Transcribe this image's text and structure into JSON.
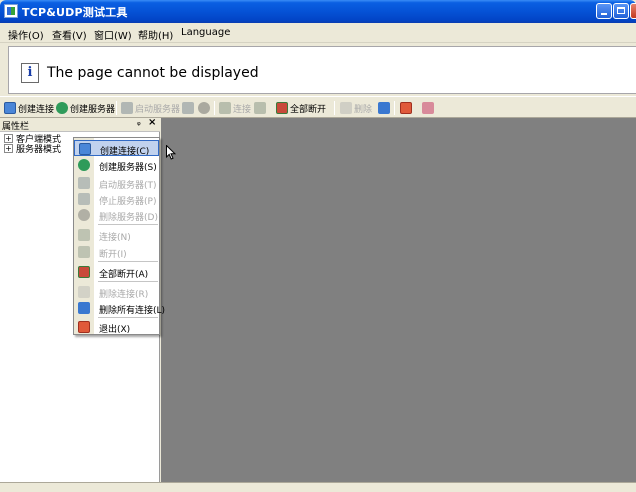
{
  "window": {
    "title": "TCP&UDP测试工具"
  },
  "menubar": {
    "items": [
      {
        "label": "操作(O)"
      },
      {
        "label": "查看(V)"
      },
      {
        "label": "窗口(W)"
      },
      {
        "label": "帮助(H)"
      },
      {
        "label": "Language"
      }
    ]
  },
  "error": {
    "message": "The page cannot be displayed"
  },
  "toolbar": {
    "items": [
      {
        "label": "创建连接",
        "icon": "create-connection-icon",
        "enabled": true
      },
      {
        "label": "创建服务器",
        "icon": "create-server-icon",
        "enabled": true
      },
      {
        "label": "启动服务器",
        "icon": "start-server-icon",
        "enabled": false
      },
      {
        "label": "连接",
        "icon": "connect-icon",
        "enabled": false
      },
      {
        "label": "全部断开",
        "icon": "disconnect-all-icon",
        "enabled": true
      },
      {
        "label": "删除",
        "icon": "delete-icon",
        "enabled": false
      }
    ]
  },
  "leftpanel": {
    "title": "属性栏",
    "pin": "ᵩ",
    "close": "×",
    "tree": [
      {
        "label": "客户端模式",
        "expander": "+"
      },
      {
        "label": "服务器模式",
        "expander": "+"
      }
    ]
  },
  "context_menu": {
    "items": [
      {
        "label": "创建连接(C)",
        "enabled": true,
        "highlighted": true,
        "icon": "create-connection-icon"
      },
      {
        "label": "创建服务器(S)",
        "enabled": true,
        "icon": "create-server-icon"
      },
      {
        "label": "启动服务器(T)",
        "enabled": false,
        "icon": "start-server-icon"
      },
      {
        "label": "停止服务器(P)",
        "enabled": false,
        "icon": "stop-server-icon"
      },
      {
        "label": "删除服务器(D)",
        "enabled": false,
        "icon": "delete-server-icon"
      },
      {
        "label": "连接(N)",
        "enabled": false,
        "icon": "connect-icon"
      },
      {
        "label": "断开(I)",
        "enabled": false,
        "icon": "disconnect-icon"
      },
      {
        "label": "全部断开(A)",
        "enabled": true,
        "icon": "disconnect-all-icon"
      },
      {
        "label": "删除连接(R)",
        "enabled": false,
        "icon": "delete-connection-icon"
      },
      {
        "label": "删除所有连接(L)",
        "enabled": true,
        "icon": "delete-all-connections-icon"
      },
      {
        "label": "退出(X)",
        "enabled": true,
        "icon": "exit-icon"
      }
    ]
  },
  "colors": {
    "titlebar": "#0552d6",
    "mdi_background": "#808080",
    "menu_highlight": "#c1d2ee"
  }
}
